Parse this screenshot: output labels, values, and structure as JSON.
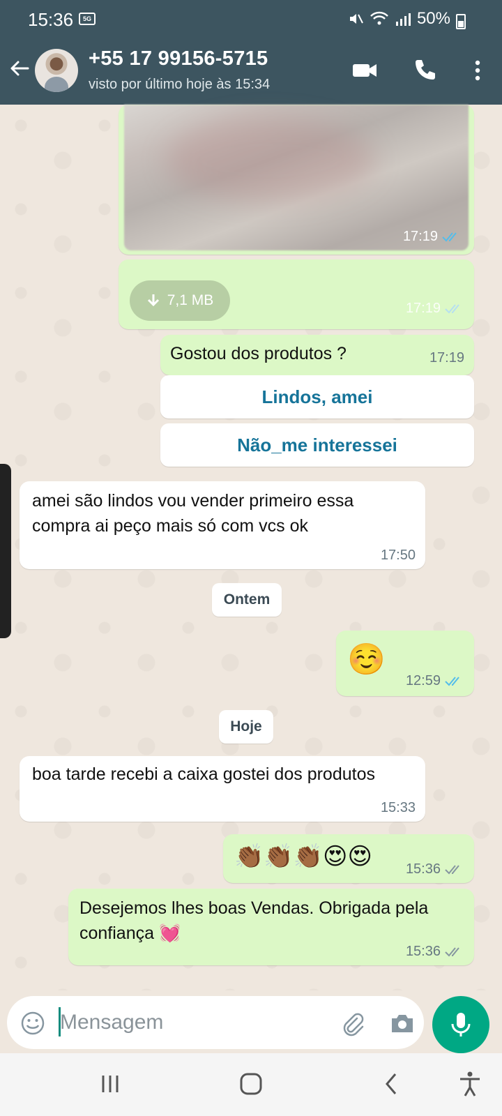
{
  "status_bar": {
    "time": "15:36",
    "battery": "50%"
  },
  "header": {
    "contact_name": "+55 17 99156-5715",
    "last_seen": "visto por último hoje às 15:34"
  },
  "messages": {
    "image_time": "17:19",
    "file_size": "7,1 MB",
    "file_time": "17:19",
    "question_text": "Gostou dos produtos ?",
    "question_time": "17:19",
    "reply_button_1": "Lindos, amei",
    "reply_button_2": "Não_me interessei",
    "incoming_1_text": "amei são  lindos vou vender primeiro essa compra ai peço  mais só  com vcs ok",
    "incoming_1_time": "17:50",
    "date_pill_1": "Ontem",
    "emoji_msg_text": "☺️",
    "emoji_msg_time": "12:59",
    "date_pill_2": "Hoje",
    "incoming_2_text": "boa tarde recebi a caixa gostei dos produtos",
    "incoming_2_time": "15:33",
    "emoji_msg_2_text": "👏🏾👏🏾👏🏾😍😍",
    "emoji_msg_2_time": "15:36",
    "outgoing_final_text": "Desejemos lhes boas Vendas. Obrigada pela confiança 💓",
    "outgoing_final_time": "15:36"
  },
  "composer": {
    "placeholder": "Mensagem"
  },
  "icons": {
    "back": "arrow-left-icon",
    "video": "video-call-icon",
    "call": "phone-icon",
    "menu": "more-vert-icon",
    "emoji": "emoji-icon",
    "attach": "paperclip-icon",
    "camera": "camera-icon",
    "mic": "microphone-icon"
  },
  "colors": {
    "header": "#3d5560",
    "outgoing_bubble": "#dcf8c6",
    "incoming_bubble": "#ffffff",
    "button_text": "#167499",
    "accent": "#00a884",
    "read_ticks": "#53bdeb"
  }
}
